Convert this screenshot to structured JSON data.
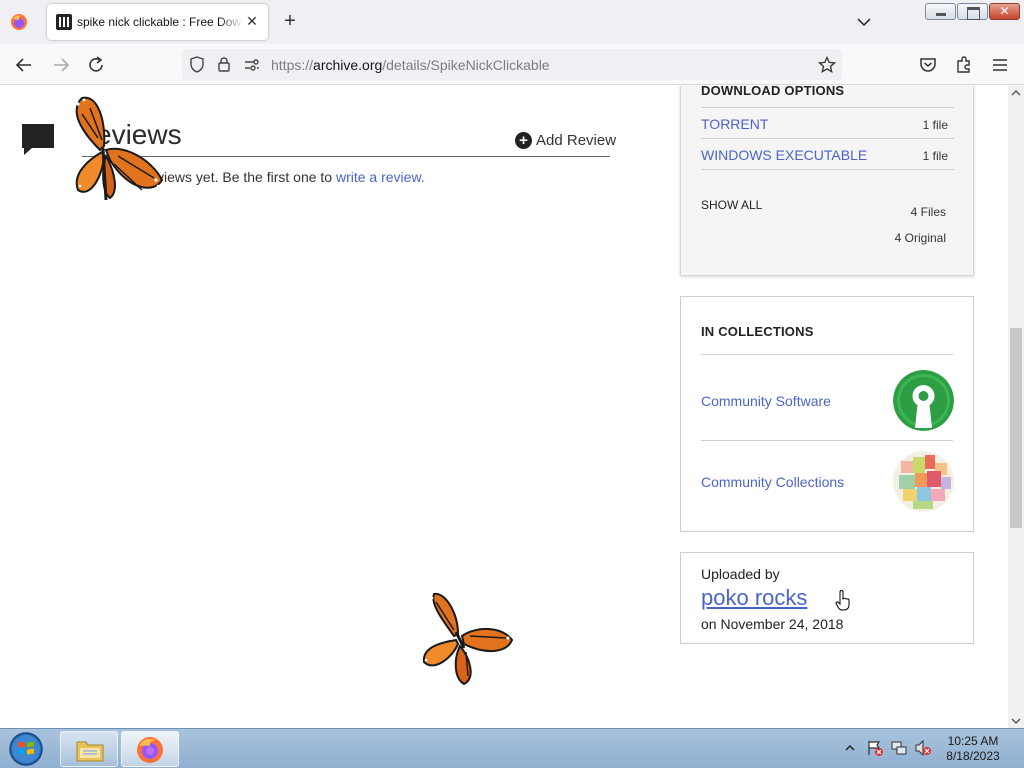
{
  "browser": {
    "tab": {
      "title": "spike nick clickable : Free Download, Borrow, and Streaming : Internet Archive",
      "close_glyph": "✕"
    },
    "new_tab_glyph": "+",
    "url": {
      "scheme": "https://",
      "host": "archive.org",
      "path": "/details/SpikeNickClickable"
    }
  },
  "reviews": {
    "title": "Reviews",
    "title_visible": "eviews",
    "add_review": "Add Review",
    "lead_visible": "T",
    "empty_text": "reviews yet. Be the first one to",
    "write_review_link": "write a review."
  },
  "download_options": {
    "header": "DOWNLOAD OPTIONS",
    "rows": [
      {
        "label": "TORRENT",
        "count": "1 file"
      },
      {
        "label": "WINDOWS EXECUTABLE",
        "count": "1 file"
      }
    ],
    "show_all": "SHOW ALL",
    "total_files": "4 Files",
    "total_original": "4 Original"
  },
  "collections": {
    "header": "IN COLLECTIONS",
    "items": [
      {
        "label": "Community Software",
        "icon": "keyhole-logo-icon"
      },
      {
        "label": "Community Collections",
        "icon": "collage-logo-icon"
      }
    ]
  },
  "uploader": {
    "label": "Uploaded by",
    "user": "poko rocks",
    "date": "on November 24, 2018"
  },
  "taskbar": {
    "time": "10:25 AM",
    "date": "8/18/2023"
  },
  "colors": {
    "link": "#4b64c9",
    "firefox_orange": "#ff7139",
    "keyhole_green": "#2e9e44",
    "butterfly_orange": "#e2731e"
  }
}
